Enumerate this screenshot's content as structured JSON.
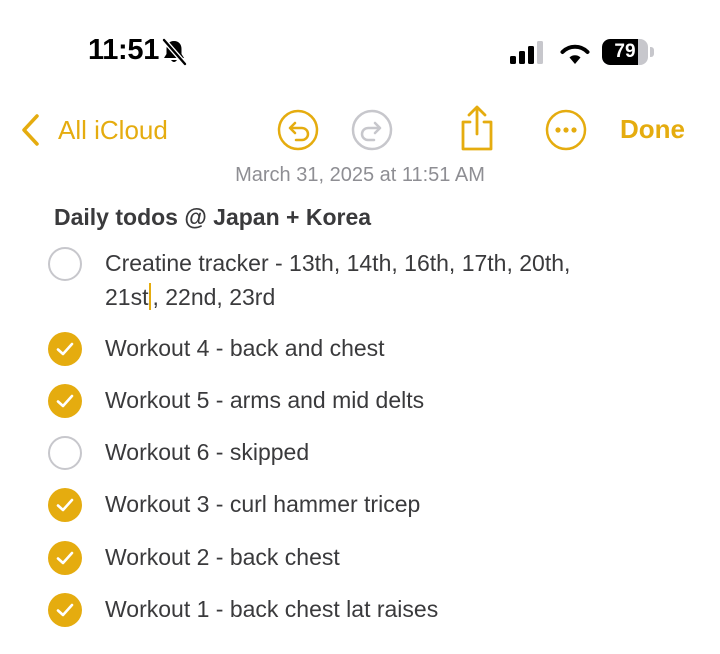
{
  "status_bar": {
    "time": "11:51",
    "battery_level": "79",
    "battery_fraction": 0.79,
    "icons": [
      "bell-slash-icon",
      "cellular-signal-icon",
      "wifi-icon",
      "battery-icon"
    ]
  },
  "toolbar": {
    "back_label": "All iCloud",
    "done_label": "Done",
    "icons": [
      "chevron-left-icon",
      "undo-icon",
      "redo-icon",
      "share-icon",
      "more-icon"
    ]
  },
  "note": {
    "date": "March 31, 2025 at 11:51 AM",
    "title": "Daily todos @ Japan + Korea",
    "todos": [
      {
        "line1": "Creatine tracker  - 13th, 14th, 16th, 17th, 20th,",
        "line2a": "21st",
        "line2b": ", 22nd, 23rd",
        "checked": false
      },
      {
        "text": "Workout 4 - back and chest",
        "checked": true
      },
      {
        "text": "Workout 5 - arms and mid delts",
        "checked": true
      },
      {
        "text": "Workout 6 - skipped",
        "checked": false
      },
      {
        "text": "Workout 3 - curl hammer tricep",
        "checked": true
      },
      {
        "text": "Workout 2 - back chest",
        "checked": true
      },
      {
        "text": "Workout 1 - back chest lat raises",
        "checked": true
      }
    ]
  },
  "colors": {
    "accent": "#e5ac0f",
    "secondary_text": "#8e8e93",
    "unchecked_ring": "#c7c7cc",
    "body_text": "#3a3a3c"
  }
}
